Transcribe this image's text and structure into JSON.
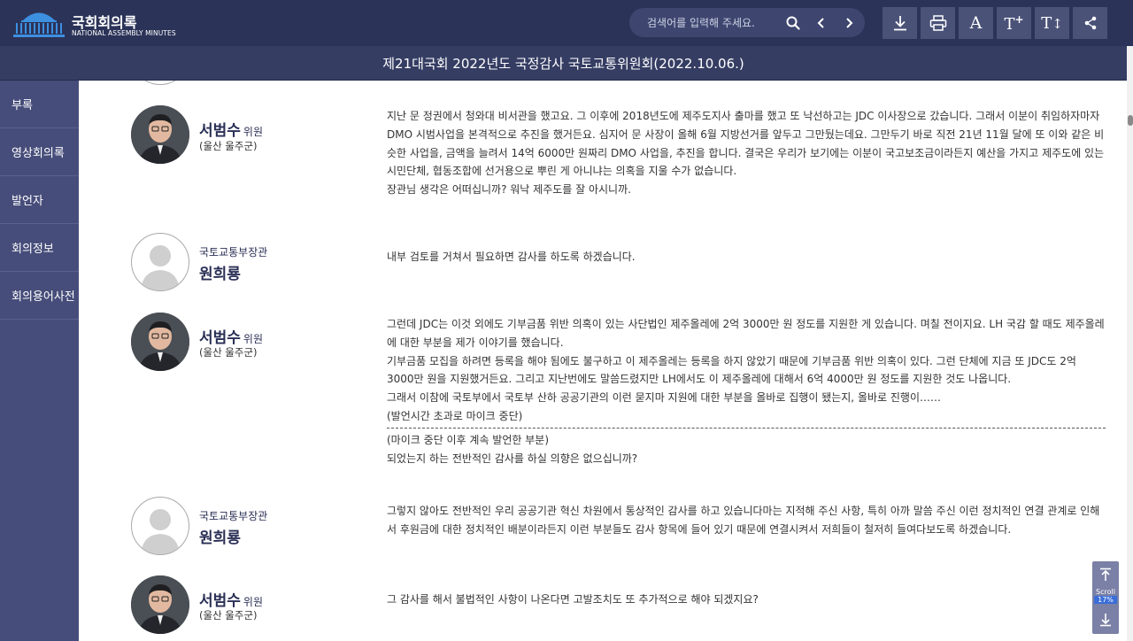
{
  "app": {
    "title": "국회회의록",
    "subtitle": "NATIONAL ASSEMBLY MINUTES"
  },
  "search": {
    "placeholder": "검색어를 입력해 주세요."
  },
  "document": {
    "title": "제21대국회 2022년도 국정감사 국토교통위원회(2022.10.06.)"
  },
  "sidebar": {
    "items": [
      {
        "label": "부록"
      },
      {
        "label": "영상회의록"
      },
      {
        "label": "발언자"
      },
      {
        "label": "회의정보"
      },
      {
        "label": "회의용어사전"
      }
    ]
  },
  "toolbar": {
    "font_label": "A",
    "font_up_label": "T",
    "font_up_sup": "+",
    "line_label": "T"
  },
  "speeches": [
    {
      "speaker": "서범수",
      "role": "위원",
      "sub": "(울산 울주군)",
      "paragraphs": [
        " 지난 문 정권에서 청와대 비서관을 했고요. 그 이후에 2018년도에 제주도지사 출마를 했고 또 낙선하고는 JDC 이사장으로 갔습니다. 그래서 이분이 취임하자마자 DMO 시범사업을 본격적으로 추진을 했거든요. 심지어 문 사장이 올해 6월 지방선거를 앞두고 그만뒀는데요. 그만두기 바로 직전 21년 11월 달에 또 이와 같은 비슷한 사업을, 금액을 늘려서 14억 6000만 원짜리 DMO 사업을, 추진을 합니다. 결국은 우리가 보기에는 이분이 국고보조금이라든지 예산을 가지고 제주도에 있는 시민단체, 협동조합에 선거용으로 뿌린 게 아니냐는 의혹을 지울 수가 없습니다.",
        " 장관님 생각은 어떠십니까? 워낙 제주도를 잘 아시니까."
      ]
    },
    {
      "speaker_title": "국토교통부장관",
      "speaker": "원희룡",
      "paragraphs": [
        " 내부 검토를 거쳐서 필요하면 감사를 하도록 하겠습니다."
      ]
    },
    {
      "speaker": "서범수",
      "role": "위원",
      "sub": "(울산 울주군)",
      "paragraphs": [
        " 그런데 JDC는 이것 외에도 기부금품 위반 의혹이 있는 사단법인 제주올레에 2억 3000만 원 정도를 지원한 게 있습니다. 며칠 전이지요. LH 국감 할 때도 제주올레에 대한 부분을 제가 이야기를 했습니다.",
        " 기부금품 모집을 하려면 등록을 해야 됨에도 불구하고 이 제주올레는 등록을 하지 않았기 때문에 기부금품 위반 의혹이 있다. 그런 단체에 지금 또 JDC도 2억 3000만 원을 지원했거든요. 그리고 지난번에도 말씀드렸지만 LH에서도 이 제주올레에 대해서 6억 4000만 원 정도를 지원한 것도 나옵니다.",
        " 그래서 이참에 국토부에서 국토부 산하 공공기관의 이런 묻지마 지원에 대한 부분을 올바로 집행이 됐는지, 올바로 진행이……",
        " (발언시간 초과로 마이크 중단)"
      ],
      "after_divider": [
        " (마이크 중단 이후 계속 발언한 부분)",
        "되었는지 하는 전반적인 감사를 하실 의향은 없으십니까?"
      ]
    },
    {
      "speaker_title": "국토교통부장관",
      "speaker": "원희룡",
      "paragraphs": [
        " 그렇지 않아도 전반적인 우리 공공기관 혁신 차원에서 통상적인 감사를 하고 있습니다마는 지적해 주신 사항, 특히 아까 말씀 주신 이런 정치적인 연결 관계로 인해서 후원금에 대한 정치적인 배분이라든지 이런 부분들도 감사 항목에 들어 있기 때문에 연결시켜서 저희들이 철저히 들여다보도록 하겠습니다."
      ]
    },
    {
      "speaker": "서범수",
      "role": "위원",
      "sub": "(울산 울주군)",
      "paragraphs": [
        " 그 감사를 해서 불법적인 사항이 나온다면 고발조치도 또 추가적으로 해야 되겠지요?"
      ]
    }
  ],
  "scroll": {
    "label": "Scroll",
    "value": "17%"
  },
  "colors": {
    "header_bg": "#2b3358",
    "titlebar_bg": "#353d63",
    "sidebar_bg": "#464d7a",
    "accent_name": "#2a2f55",
    "scroll_value_bg": "#3a6ed8"
  },
  "icons": {
    "logo": "national-assembly-building-icon",
    "search": "search-icon",
    "prev": "chevron-left-icon",
    "next": "chevron-right-icon",
    "download": "download-icon",
    "print": "print-icon",
    "font_size": "font-icon",
    "font_increase": "font-increase-icon",
    "line_height": "line-height-icon",
    "share": "share-icon",
    "scroll_top": "arrow-up-to-line-icon",
    "scroll_bottom": "arrow-down-to-line-icon"
  }
}
